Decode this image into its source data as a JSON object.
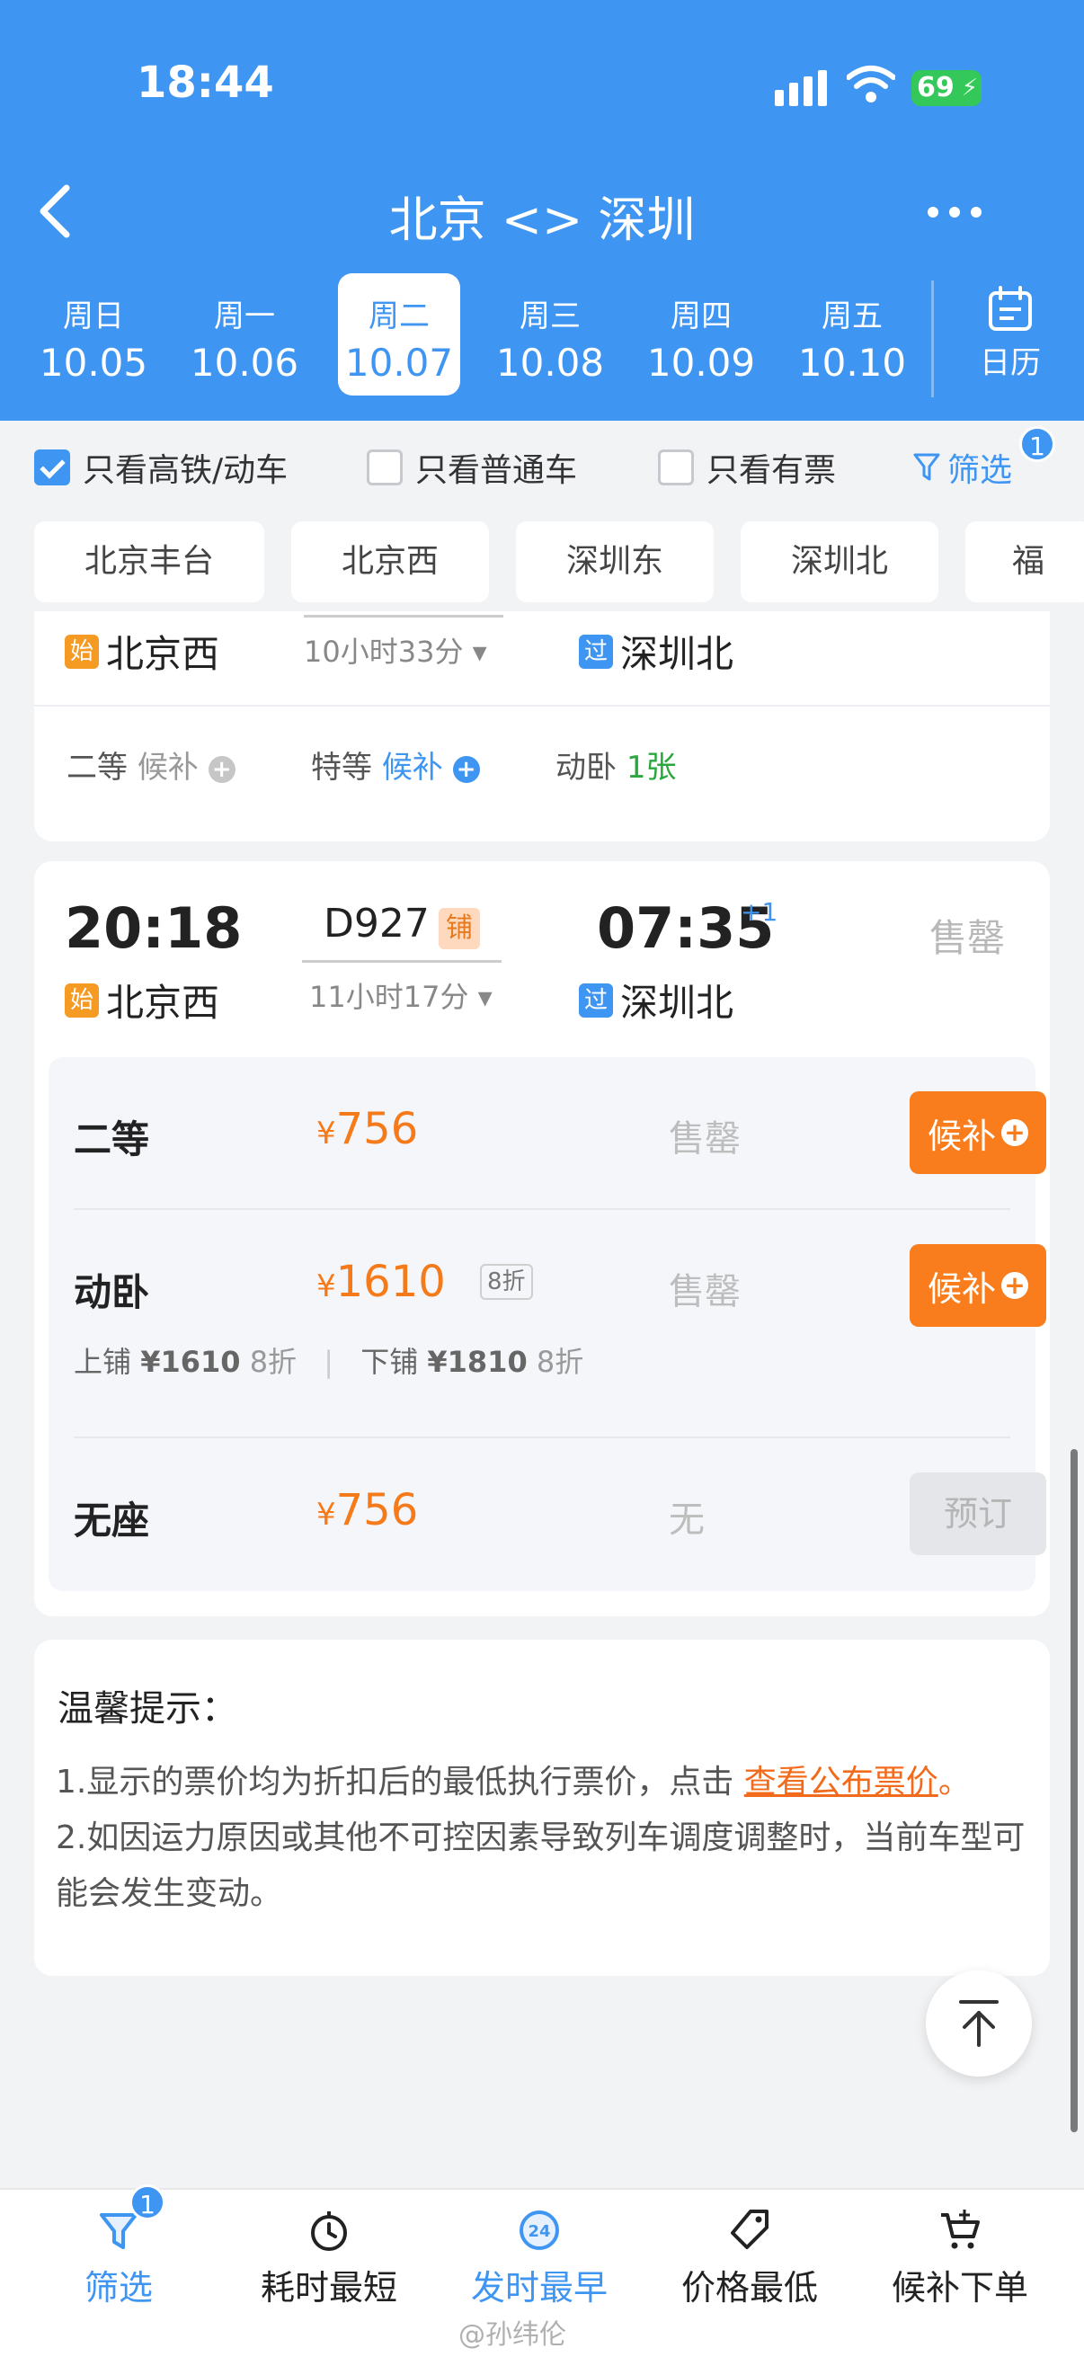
{
  "status_bar": {
    "time": "18:44",
    "battery": "69"
  },
  "nav": {
    "title": "北京 <> 深圳"
  },
  "dates": [
    {
      "dow": "周日",
      "date": "10.05"
    },
    {
      "dow": "周一",
      "date": "10.06"
    },
    {
      "dow": "周二",
      "date": "10.07",
      "active": true
    },
    {
      "dow": "周三",
      "date": "10.08"
    },
    {
      "dow": "周四",
      "date": "10.09"
    },
    {
      "dow": "周五",
      "date": "10.10"
    }
  ],
  "calendar_label": "日历",
  "filters": {
    "high_speed": "只看高铁/动车",
    "normal": "只看普通车",
    "available": "只看有票",
    "filter_label": "筛选",
    "filter_badge": "1"
  },
  "stations": [
    "北京丰台",
    "北京西",
    "深圳东",
    "深圳北",
    "福"
  ],
  "prev_card": {
    "duration": "10小时33分",
    "from_mark": "始",
    "from": "北京西",
    "to_mark": "过",
    "to": "深圳北",
    "seats": [
      {
        "name": "二等",
        "status": "候补"
      },
      {
        "name": "特等",
        "status": "候补"
      },
      {
        "name": "动卧",
        "status": "1张"
      }
    ]
  },
  "train": {
    "depart": "20:18",
    "number": "D927",
    "tag": "铺",
    "duration": "11小时17分",
    "arrive": "07:35",
    "plus_day": "+1",
    "status": "售罄",
    "from_mark": "始",
    "from": "北京西",
    "to_mark": "过",
    "to": "深圳北",
    "seats": [
      {
        "name": "二等",
        "currency": "¥",
        "price": "756",
        "status": "售罄",
        "action": "候补"
      },
      {
        "name": "动卧",
        "currency": "¥",
        "price": "1610",
        "discount": "8折",
        "status": "售罄",
        "action": "候补"
      },
      {
        "name": "无座",
        "currency": "¥",
        "price": "756",
        "status": "无",
        "action": "预订"
      }
    ],
    "berths": {
      "upper_label": "上铺",
      "upper_price": "¥1610",
      "upper_disc": "8折",
      "lower_label": "下铺",
      "lower_price": "¥1810",
      "lower_disc": "8折"
    }
  },
  "notice": {
    "title": "温馨提示：",
    "line1_pre": "1.显示的票价均为折扣后的最低执行票价，点击 ",
    "line1_link": "查看公布票价",
    "line1_post": "。",
    "line2": "2.如因运力原因或其他不可控因素导致列车调度调整时，当前车型可能会发生变动。"
  },
  "bottom_tabs": [
    {
      "label": "筛选",
      "badge": "1",
      "icon": "filter-icon"
    },
    {
      "label": "耗时最短",
      "icon": "stopwatch-icon"
    },
    {
      "label": "发时最早",
      "icon": "clock-24-icon",
      "active": true
    },
    {
      "label": "价格最低",
      "icon": "price-tag-icon"
    },
    {
      "label": "候补下单",
      "icon": "cart-add-icon"
    }
  ],
  "watermark": "@孙纬伦",
  "colors": {
    "primary": "#3f95f2",
    "accent": "#f97d1c",
    "sold": "#b8b8b8"
  }
}
